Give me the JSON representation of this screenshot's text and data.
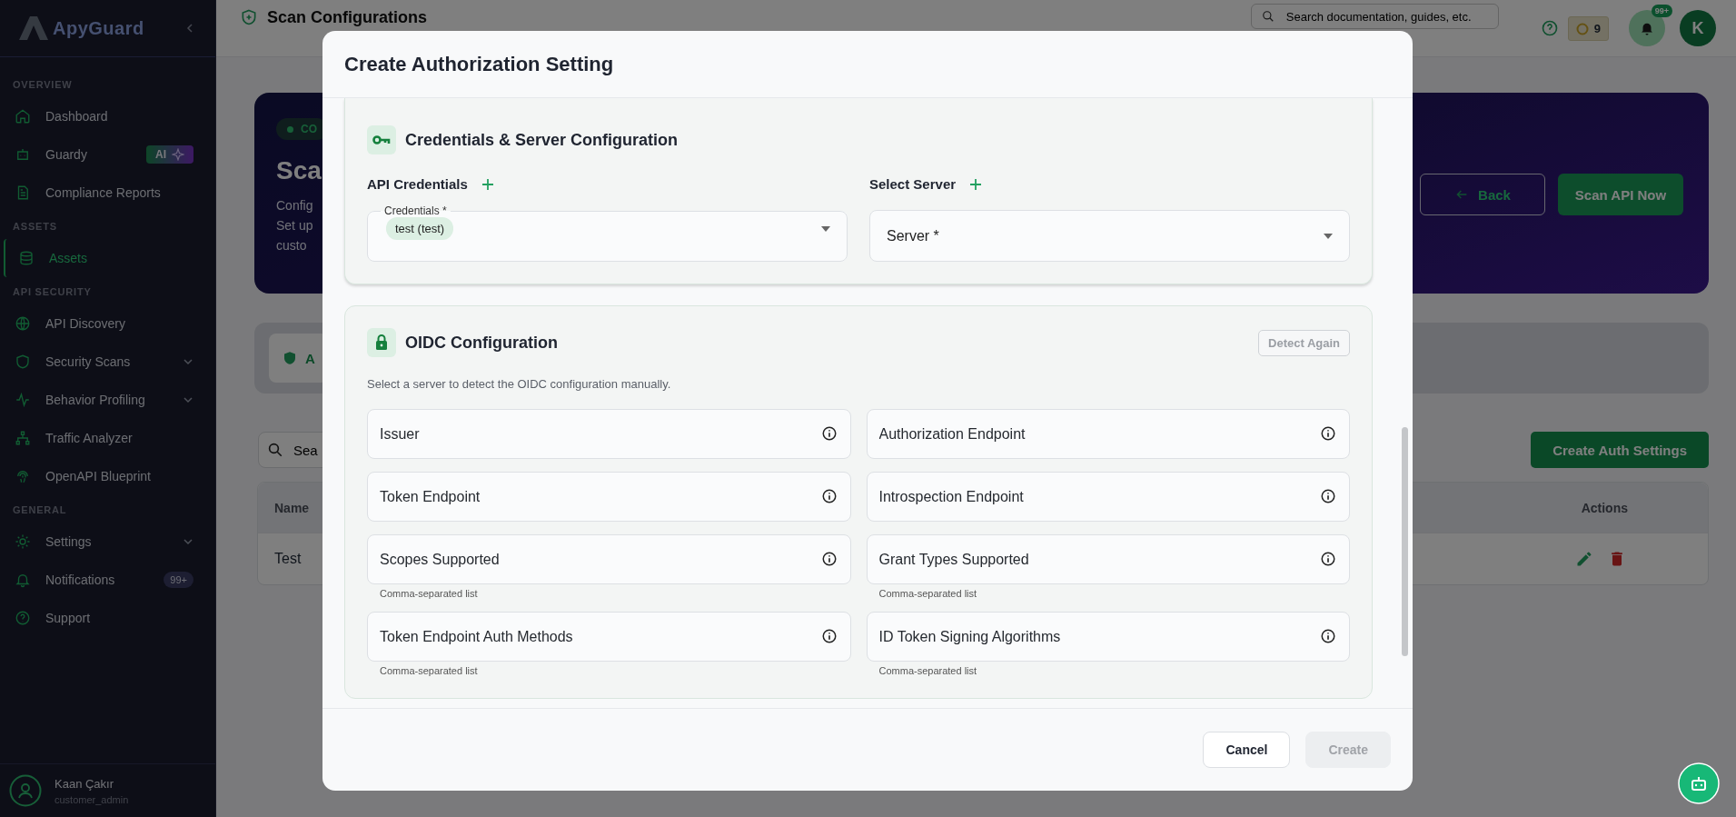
{
  "sidebar": {
    "logo": "ApyGuard",
    "sections": [
      {
        "title": "OVERVIEW",
        "items": [
          {
            "label": "Dashboard",
            "selected": false,
            "expandable": false
          },
          {
            "label": "Guardy",
            "selected": false,
            "expandable": false,
            "badge": {
              "kind": "ai",
              "text": "AI"
            }
          },
          {
            "label": "Compliance Reports",
            "selected": false,
            "expandable": false
          }
        ]
      },
      {
        "title": "ASSETS",
        "items": [
          {
            "label": "Assets",
            "selected": true,
            "expandable": false
          }
        ]
      },
      {
        "title": "API SECURITY",
        "items": [
          {
            "label": "API Discovery",
            "selected": false,
            "expandable": false
          },
          {
            "label": "Security Scans",
            "selected": false,
            "expandable": true
          },
          {
            "label": "Behavior Profiling",
            "selected": false,
            "expandable": true
          },
          {
            "label": "Traffic Analyzer",
            "selected": false,
            "expandable": false
          },
          {
            "label": "OpenAPI Blueprint",
            "selected": false,
            "expandable": false
          }
        ]
      },
      {
        "title": "GENERAL",
        "items": [
          {
            "label": "Settings",
            "selected": false,
            "expandable": true
          },
          {
            "label": "Notifications",
            "selected": false,
            "expandable": false,
            "badge": {
              "kind": "count",
              "text": "99+"
            }
          },
          {
            "label": "Support",
            "selected": false,
            "expandable": false
          }
        ]
      }
    ],
    "user": {
      "name": "Kaan Çakır",
      "role": "customer_admin"
    }
  },
  "topbar": {
    "title": "Scan Configurations",
    "search": {
      "placeholder": "Search documentation, guides, etc."
    },
    "coins": "9",
    "notifications": "99+",
    "avatar": "K"
  },
  "hero": {
    "chip": "CO",
    "title": "Sca",
    "description": [
      "Config",
      "Set up",
      "custo"
    ],
    "buttons": [
      {
        "label": "Back",
        "kind": "outline"
      },
      {
        "label": "Scan API Now",
        "kind": "primary"
      }
    ]
  },
  "tab_bar": {
    "tabs": [
      {
        "label": "A",
        "selected": true
      }
    ]
  },
  "toolbar": {
    "search": {
      "placeholder": "Sea"
    },
    "button": "Create Auth Settings"
  },
  "table": {
    "columns": [
      "Name",
      "Actions"
    ],
    "rows": [
      {
        "name": "Test"
      }
    ]
  },
  "modal": {
    "title": "Create Authorization Setting",
    "credentials_section": {
      "title": "Credentials & Server Configuration",
      "api_credentials": {
        "label": "API Credentials",
        "field_label": "Credentials *",
        "chips": [
          "test (test)"
        ]
      },
      "server": {
        "label": "Select Server",
        "placeholder": "Server *"
      }
    },
    "oidc_section": {
      "title": "OIDC Configuration",
      "detect_button": {
        "label": "Detect Again",
        "disabled": true
      },
      "description": "Select a server to detect the OIDC configuration manually.",
      "fields": [
        {
          "placeholder": "Issuer"
        },
        {
          "placeholder": "Authorization Endpoint"
        },
        {
          "placeholder": "Token Endpoint"
        },
        {
          "placeholder": "Introspection Endpoint"
        },
        {
          "placeholder": "Scopes Supported",
          "helper": "Comma-separated list"
        },
        {
          "placeholder": "Grant Types Supported",
          "helper": "Comma-separated list"
        },
        {
          "placeholder": "Token Endpoint Auth Methods",
          "helper": "Comma-separated list"
        },
        {
          "placeholder": "ID Token Signing Algorithms",
          "helper": "Comma-separated list"
        }
      ]
    },
    "buttons": [
      {
        "label": "Cancel",
        "disabled": false
      },
      {
        "label": "Create",
        "disabled": true
      }
    ]
  }
}
